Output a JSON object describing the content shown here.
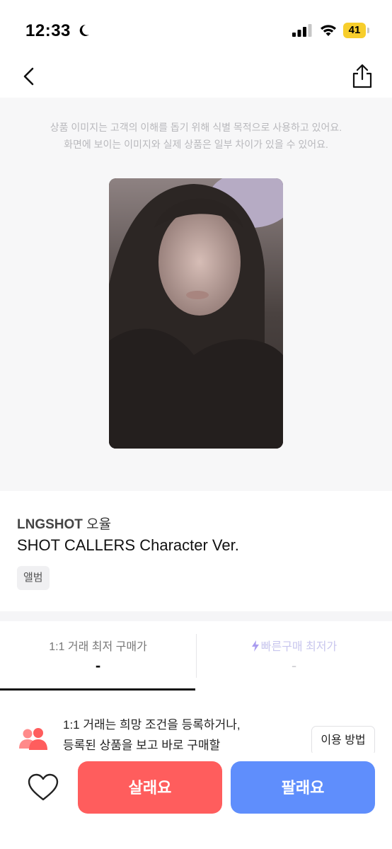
{
  "status_bar": {
    "time": "12:33",
    "battery": "41",
    "icons": [
      "moon-icon",
      "signal-icon",
      "wifi-icon",
      "battery-icon"
    ]
  },
  "nav": {
    "icons": [
      "back-arrow-icon",
      "share-icon"
    ]
  },
  "image_notice": {
    "line1": "상품 이미지는 고객의 이해를 돕기 위해 식별 목적으로 사용하고 있어요.",
    "line2": "화면에 보이는 이미지와 실제 상품은 일부 차이가 있을 수 있어요."
  },
  "product": {
    "group": "LNGSHOT",
    "member": "오율",
    "title": "SHOT CALLERS Character Ver.",
    "tag": "앨범"
  },
  "tabs": [
    {
      "label": "1:1 거래 최저 구매가",
      "value": "-",
      "active": true
    },
    {
      "label": "빠른구매 최저가",
      "value": "-",
      "active": false,
      "icon": "lightning-icon"
    }
  ],
  "guide": {
    "line1": "1:1 거래는 희망 조건을 등록하거나,",
    "line2": "등록된 상품을 보고 바로 구매할",
    "button": "이용 방법",
    "icon": "people-icon"
  },
  "actions": {
    "buy": "살래요",
    "sell": "팔래요",
    "icon": "heart-icon"
  },
  "colors": {
    "buy": "#ff5d5d",
    "sell": "#5f8efc",
    "battery": "#f7ce2c",
    "guide_icon": "#ff6f6f",
    "fast_buy": "#a99cf0"
  }
}
